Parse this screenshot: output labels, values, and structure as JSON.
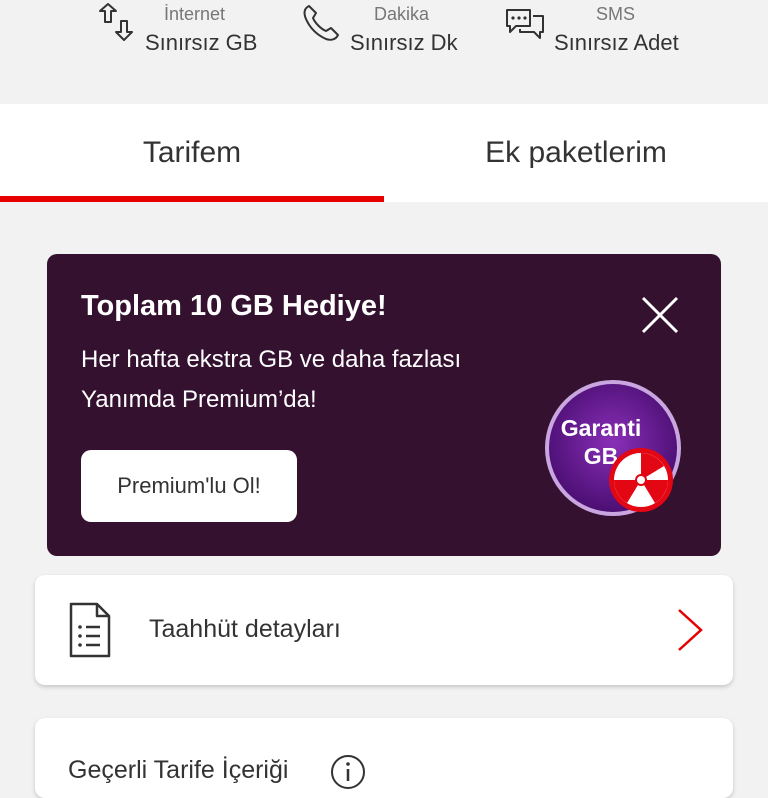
{
  "usage": {
    "internet": {
      "label": "İnternet",
      "value": "Sınırsız GB",
      "icon": "data-transfer-icon"
    },
    "minutes": {
      "label": "Dakika",
      "value": "Sınırsız Dk",
      "icon": "phone-icon"
    },
    "sms": {
      "label": "SMS",
      "value": "Sınırsız Adet",
      "icon": "chat-bubbles-icon"
    }
  },
  "tabs": [
    {
      "label": "Tarifem",
      "active": true
    },
    {
      "label": "Ek paketlerim",
      "active": false
    }
  ],
  "promo": {
    "title": "Toplam 10 GB Hediye!",
    "line1": "Her hafta ekstra GB ve daha fazlası",
    "line2": "Yanımda Premium’da!",
    "button": "Premium'lu Ol!",
    "badge_line1": "Garanti",
    "badge_line2": "GB"
  },
  "list": {
    "commitment": {
      "label": "Taahhüt detayları",
      "icon": "document-icon"
    }
  },
  "bottom": {
    "label": "Geçerli Tarife İçeriği"
  },
  "colors": {
    "accent": "#e60000",
    "promo_bg": "#33112f",
    "page_bg": "#f2f2f2"
  }
}
